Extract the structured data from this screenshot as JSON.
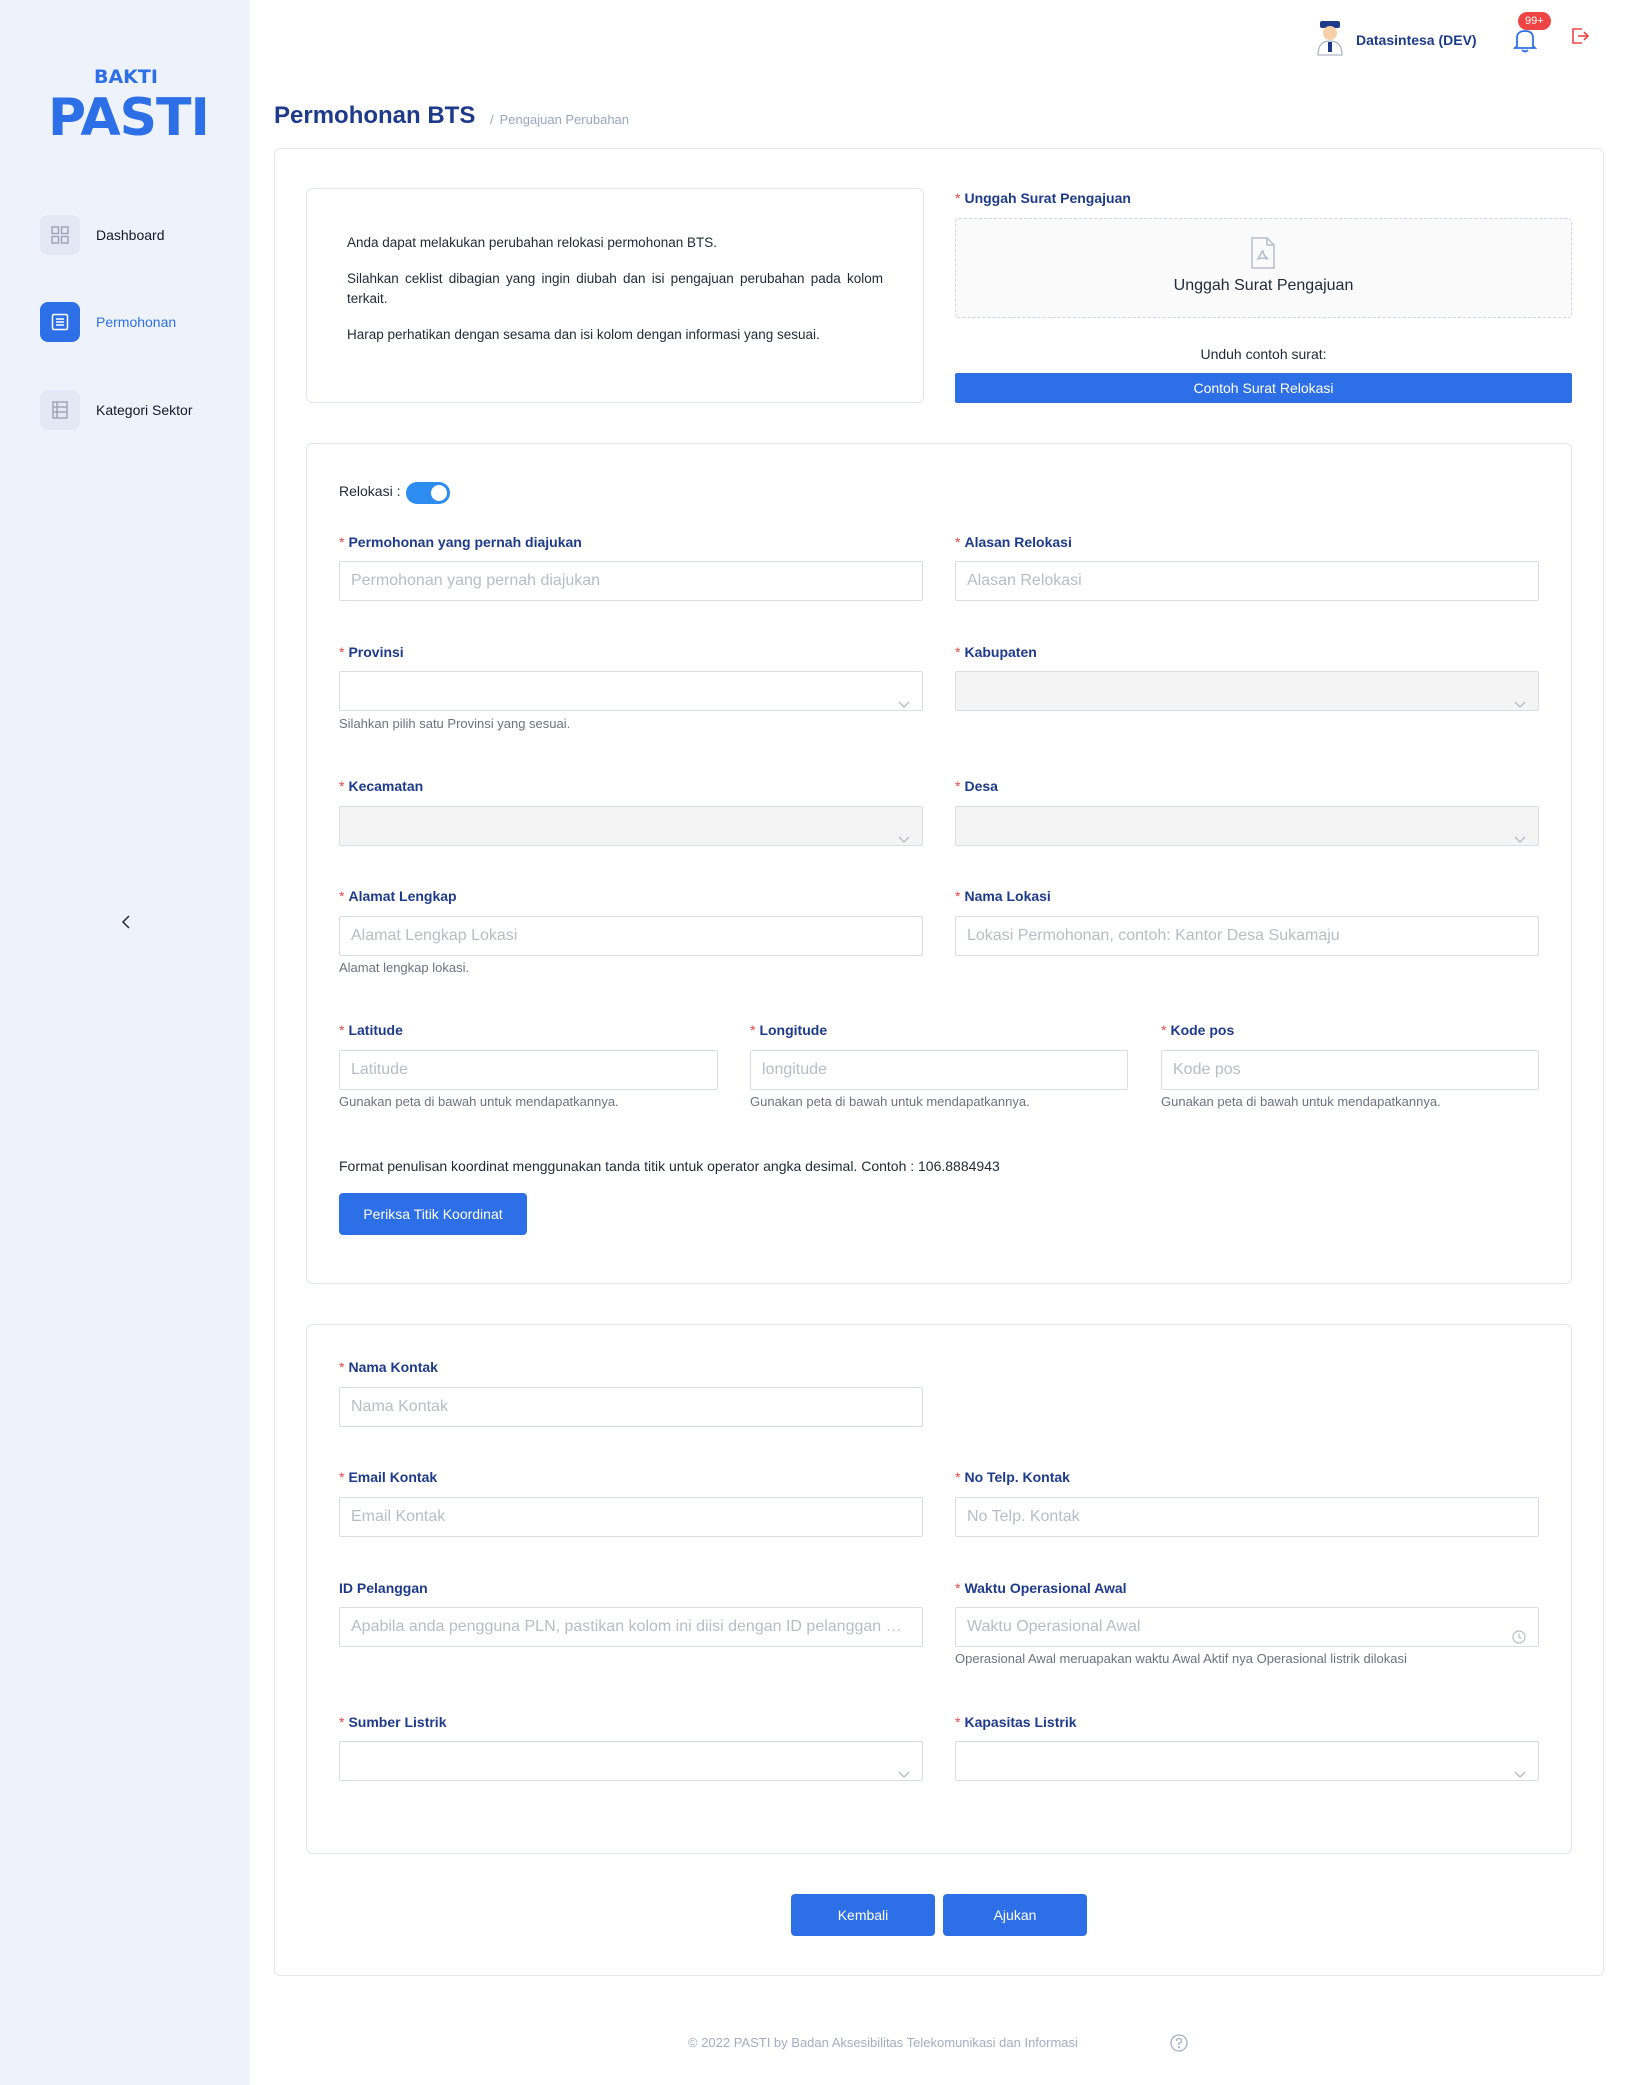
{
  "brand": {
    "top": "BAKTI",
    "main": "PASTI"
  },
  "sidebar": {
    "items": [
      {
        "label": "Dashboard",
        "icon": "grid-icon"
      },
      {
        "label": "Permohonan",
        "icon": "document-list-icon"
      },
      {
        "label": "Kategori Sektor",
        "icon": "table-icon"
      }
    ],
    "collapse_icon": "chevron-left-icon"
  },
  "header": {
    "user_name": "Datasintesa (DEV)",
    "notification_badge": "99+"
  },
  "page": {
    "title": "Permohonan BTS",
    "breadcrumb_sep": "/",
    "breadcrumb": "Pengajuan Perubahan"
  },
  "info": {
    "p1": "Anda dapat melakukan perubahan relokasi permohonan BTS.",
    "p2": "Silahkan ceklist dibagian yang ingin diubah dan isi pengajuan perubahan pada kolom terkait.",
    "p3": "Harap perhatikan dengan sesama dan isi kolom dengan informasi yang sesuai."
  },
  "upload": {
    "label": "Unggah Surat Pengajuan",
    "box_text": "Unggah Surat Pengajuan",
    "sample_label": "Unduh contoh surat:",
    "sample_button": "Contoh Surat Relokasi"
  },
  "relokasi": {
    "toggle_label": "Relokasi :",
    "enabled": true,
    "fields": {
      "permohonan": {
        "label": "Permohonan yang pernah diajukan",
        "placeholder": "Permohonan yang pernah diajukan"
      },
      "alasan": {
        "label": "Alasan Relokasi",
        "placeholder": "Alasan Relokasi"
      },
      "provinsi": {
        "label": "Provinsi",
        "help": "Silahkan pilih satu Provinsi yang sesuai."
      },
      "kabupaten": {
        "label": "Kabupaten"
      },
      "kecamatan": {
        "label": "Kecamatan"
      },
      "desa": {
        "label": "Desa"
      },
      "alamat": {
        "label": "Alamat Lengkap",
        "placeholder": "Alamat Lengkap Lokasi",
        "help": "Alamat lengkap lokasi."
      },
      "nama_lokasi": {
        "label": "Nama Lokasi",
        "placeholder": "Lokasi Permohonan, contoh: Kantor Desa Sukamaju"
      },
      "latitude": {
        "label": "Latitude",
        "placeholder": "Latitude",
        "help": "Gunakan peta di bawah untuk mendapatkannya."
      },
      "longitude": {
        "label": "Longitude",
        "placeholder": "longitude",
        "help": "Gunakan peta di bawah untuk mendapatkannya."
      },
      "kode_pos": {
        "label": "Kode pos",
        "placeholder": "Kode pos",
        "help": "Gunakan peta di bawah untuk mendapatkannya."
      }
    },
    "coord_note": "Format penulisan koordinat menggunakan tanda titik untuk operator angka desimal. Contoh : 106.8884943",
    "check_button": "Periksa Titik Koordinat"
  },
  "contact": {
    "nama": {
      "label": "Nama Kontak",
      "placeholder": "Nama Kontak"
    },
    "email": {
      "label": "Email Kontak",
      "placeholder": "Email Kontak"
    },
    "telp": {
      "label": "No Telp. Kontak",
      "placeholder": "No Telp. Kontak"
    },
    "id_pelanggan": {
      "label": "ID Pelanggan",
      "placeholder": "Apabila anda pengguna PLN, pastikan kolom ini diisi dengan ID pelanggan PLN"
    },
    "waktu": {
      "label": "Waktu Operasional Awal",
      "placeholder": "Waktu Operasional Awal",
      "help": "Operasional Awal meruapakan waktu Awal Aktif nya Operasional listrik dilokasi"
    },
    "sumber": {
      "label": "Sumber Listrik"
    },
    "kapasitas": {
      "label": "Kapasitas Listrik"
    }
  },
  "actions": {
    "back": "Kembali",
    "submit": "Ajukan"
  },
  "footer": {
    "text": "© 2022 PASTI by Badan Aksesibilitas Telekomunikasi dan Informasi"
  },
  "colors": {
    "accent": "#2d6fe6",
    "title": "#1e3a8a",
    "required": "#ef4444",
    "sidebar_bg": "#eef3fb"
  }
}
